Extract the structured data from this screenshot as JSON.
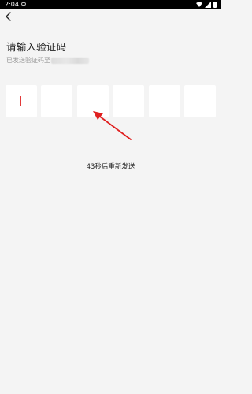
{
  "status_bar": {
    "time": "2:04",
    "icons": [
      "notification-icon",
      "wifi-icon",
      "signal-icon",
      "battery-icon"
    ]
  },
  "header": {
    "back_icon": "chevron-left-icon"
  },
  "page": {
    "title": "请输入验证码",
    "subtitle": "已发送验证码至"
  },
  "code_input": {
    "digits": [
      "",
      "",
      "",
      "",
      "",
      ""
    ],
    "caret_color": "#e23a3a"
  },
  "resend": {
    "label": "43秒后重新发送"
  },
  "annotation": {
    "arrow_color": "#e02020"
  }
}
